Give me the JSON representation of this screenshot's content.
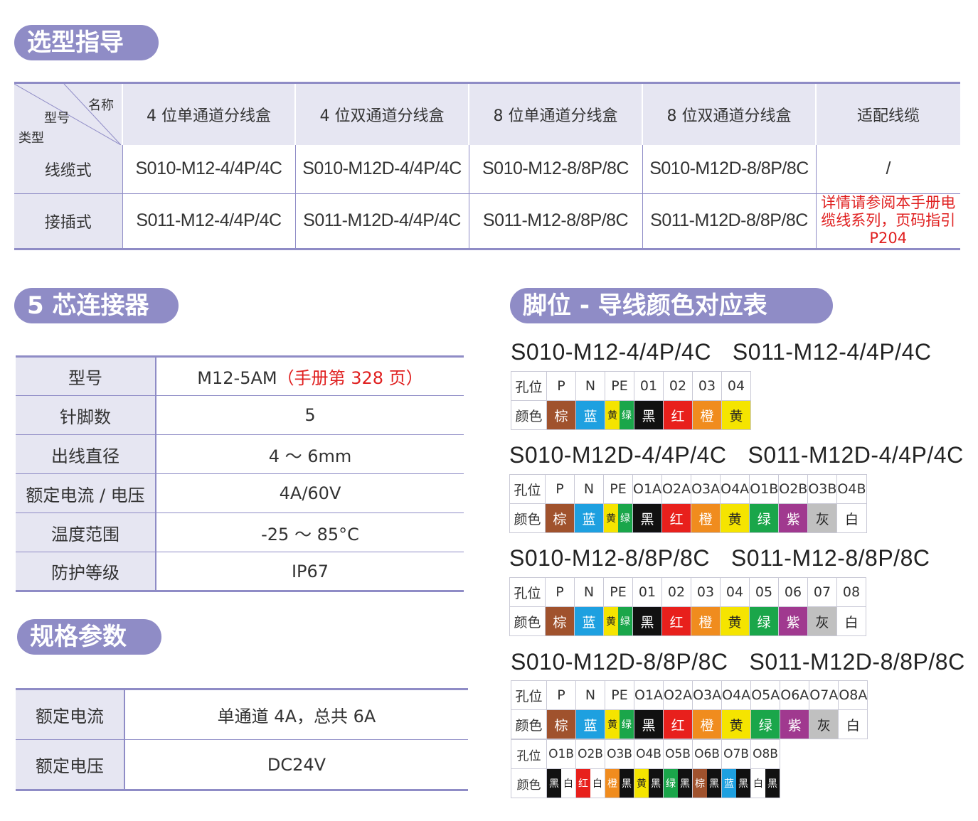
{
  "section_titles": {
    "selection": "选型指导",
    "core5": "5 芯连接器",
    "pins": "脚位 - 导线颜色对应表",
    "spec": "规格参数"
  },
  "selection": {
    "corner": {
      "name": "名称",
      "model": "型号",
      "type": "类型"
    },
    "headers": [
      "4 位单通道分线盒",
      "4 位双通道分线盒",
      "8 位单通道分线盒",
      "8 位双通道分线盒",
      "适配线缆"
    ],
    "rows": [
      {
        "label": "线缆式",
        "cells": [
          "S010-M12-4/4P/4C",
          "S010-M12D-4/4P/4C",
          "S010-M12-8/8P/8C",
          "S010-M12D-8/8P/8C",
          "/"
        ]
      },
      {
        "label": "接插式",
        "cells": [
          "S011-M12-4/4P/4C",
          "S011-M12D-4/4P/4C",
          "S011-M12-8/8P/8C",
          "S011-M12D-8/8P/8C"
        ],
        "note": "详情请参阅本手册电缆线系列，页码指引 P204"
      }
    ]
  },
  "core5": {
    "rows": [
      {
        "label": "型号",
        "value": "M12-5AM",
        "note": "（手册第 328 页）"
      },
      {
        "label": "针脚数",
        "value": "5"
      },
      {
        "label": "出线直径",
        "value": "4 ～ 6mm"
      },
      {
        "label": "额定电流 / 电压",
        "value": "4A/60V"
      },
      {
        "label": "温度范围",
        "value": "-25 ～ 85°C"
      },
      {
        "label": "防护等级",
        "value": "IP67"
      }
    ]
  },
  "spec": {
    "rows": [
      {
        "label": "额定电流",
        "value": "单通道 4A，总共 6A"
      },
      {
        "label": "额定电压",
        "value": "DC24V"
      }
    ]
  },
  "pins": {
    "row_labels": {
      "hole": "孔位",
      "color": "颜色"
    },
    "colors": {
      "棕": "#a0522d",
      "蓝": "#1ea0e0",
      "黄": "#f5e400",
      "绿": "#1aa64a",
      "黑": "#111111",
      "红": "#e8201c",
      "橙": "#f08c1e",
      "紫": "#a0398f",
      "灰": "#c0c0c0",
      "白": "#ffffff"
    },
    "tables": [
      {
        "titles": [
          "S010-M12-4/4P/4C",
          "S011-M12-4/4P/4C"
        ],
        "holes": [
          "P",
          "N",
          "PE",
          "01",
          "02",
          "03",
          "04"
        ],
        "colors": [
          "棕",
          "蓝",
          "黄|绿",
          "黑",
          "红",
          "橙",
          "黄"
        ]
      },
      {
        "titles": [
          "S010-M12D-4/4P/4C",
          "S011-M12D-4/4P/4C"
        ],
        "holes": [
          "P",
          "N",
          "PE",
          "O1A",
          "O2A",
          "O3A",
          "O4A",
          "O1B",
          "O2B",
          "O3B",
          "O4B"
        ],
        "colors": [
          "棕",
          "蓝",
          "黄|绿",
          "黑",
          "红",
          "橙",
          "黄",
          "绿",
          "紫",
          "灰",
          "白"
        ]
      },
      {
        "titles": [
          "S010-M12-8/8P/8C",
          "S011-M12-8/8P/8C"
        ],
        "holes": [
          "P",
          "N",
          "PE",
          "01",
          "02",
          "03",
          "04",
          "05",
          "06",
          "07",
          "08"
        ],
        "colors": [
          "棕",
          "蓝",
          "黄|绿",
          "黑",
          "红",
          "橙",
          "黄",
          "绿",
          "紫",
          "灰",
          "白"
        ]
      },
      {
        "titles": [
          "S010-M12D-8/8P/8C",
          "S011-M12D-8/8P/8C"
        ],
        "holes": [
          "P",
          "N",
          "PE",
          "O1A",
          "O2A",
          "O3A",
          "O4A",
          "O5A",
          "O6A",
          "O7A",
          "O8A"
        ],
        "colors": [
          "棕",
          "蓝",
          "黄|绿",
          "黑",
          "红",
          "橙",
          "黄",
          "绿",
          "紫",
          "灰",
          "白"
        ],
        "holes2": [
          "O1B",
          "O2B",
          "O3B",
          "O4B",
          "O5B",
          "O6B",
          "O7B",
          "O8B"
        ],
        "colors2": [
          "黑|白",
          "红|白",
          "橙|黑",
          "黄|黑",
          "绿|黑",
          "棕|黑",
          "蓝|黑",
          "白|黑"
        ]
      }
    ]
  }
}
